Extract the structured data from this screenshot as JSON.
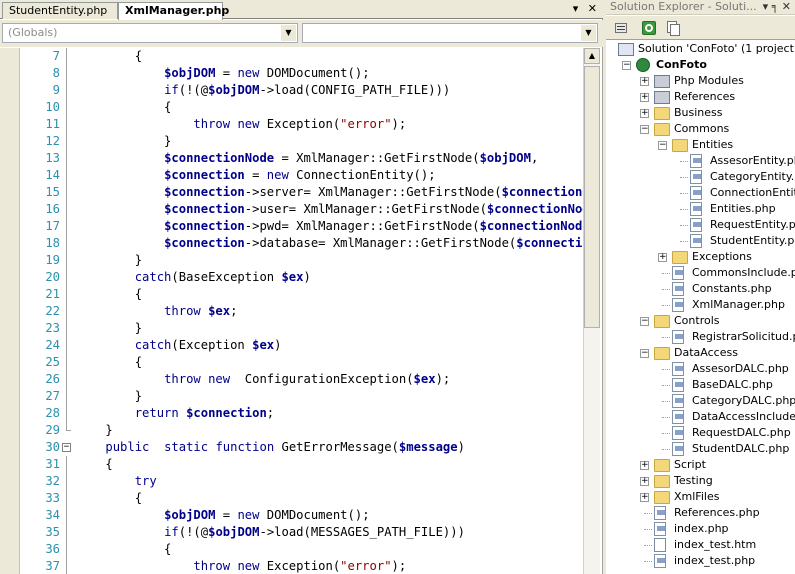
{
  "editor": {
    "tabs": [
      {
        "label": "StudentEntity.php",
        "active": false
      },
      {
        "label": "XmlManager.php",
        "active": true
      }
    ],
    "tab_controls": [
      "▾",
      "✕"
    ],
    "scope_dropdown": "(Globals)",
    "member_dropdown": "",
    "lines": [
      {
        "n": "7",
        "segs": [
          [
            "p",
            "        {"
          ]
        ]
      },
      {
        "n": "8",
        "segs": [
          [
            "p",
            "            "
          ],
          [
            "v",
            "$objDOM"
          ],
          [
            "p",
            " = "
          ],
          [
            "k",
            "new"
          ],
          [
            "p",
            " DOMDocument();"
          ]
        ]
      },
      {
        "n": "9",
        "segs": [
          [
            "p",
            "            "
          ],
          [
            "k",
            "if"
          ],
          [
            "p",
            "(!(@"
          ],
          [
            "v",
            "$objDOM"
          ],
          [
            "p",
            "->load(CONFIG_PATH_FILE)))"
          ]
        ]
      },
      {
        "n": "10",
        "segs": [
          [
            "p",
            "            {"
          ]
        ]
      },
      {
        "n": "11",
        "segs": [
          [
            "p",
            "                "
          ],
          [
            "k",
            "throw"
          ],
          [
            "p",
            " "
          ],
          [
            "k",
            "new"
          ],
          [
            "p",
            " Exception("
          ],
          [
            "s",
            "\"error\""
          ],
          [
            "p",
            ");"
          ]
        ]
      },
      {
        "n": "12",
        "segs": [
          [
            "p",
            "            }"
          ]
        ]
      },
      {
        "n": "13",
        "segs": [
          [
            "p",
            "            "
          ],
          [
            "v",
            "$connectionNode"
          ],
          [
            "p",
            " = XmlManager::GetFirstNode("
          ],
          [
            "v",
            "$objDOM"
          ],
          [
            "p",
            ","
          ]
        ]
      },
      {
        "n": "14",
        "segs": [
          [
            "p",
            "            "
          ],
          [
            "v",
            "$connection"
          ],
          [
            "p",
            " = "
          ],
          [
            "k",
            "new"
          ],
          [
            "p",
            " ConnectionEntity();"
          ]
        ]
      },
      {
        "n": "15",
        "segs": [
          [
            "p",
            "            "
          ],
          [
            "v",
            "$connection"
          ],
          [
            "p",
            "->server= XmlManager::GetFirstNode("
          ],
          [
            "v",
            "$connectionNode"
          ]
        ]
      },
      {
        "n": "16",
        "segs": [
          [
            "p",
            "            "
          ],
          [
            "v",
            "$connection"
          ],
          [
            "p",
            "->user= XmlManager::GetFirstNode("
          ],
          [
            "v",
            "$connectionNode"
          ]
        ]
      },
      {
        "n": "17",
        "segs": [
          [
            "p",
            "            "
          ],
          [
            "v",
            "$connection"
          ],
          [
            "p",
            "->pwd= XmlManager::GetFirstNode("
          ],
          [
            "v",
            "$connectionNode"
          ]
        ]
      },
      {
        "n": "18",
        "segs": [
          [
            "p",
            "            "
          ],
          [
            "v",
            "$connection"
          ],
          [
            "p",
            "->database= XmlManager::GetFirstNode("
          ],
          [
            "v",
            "$connectionNode"
          ]
        ]
      },
      {
        "n": "19",
        "segs": [
          [
            "p",
            "        }"
          ]
        ]
      },
      {
        "n": "20",
        "segs": [
          [
            "p",
            "        "
          ],
          [
            "k",
            "catch"
          ],
          [
            "p",
            "(BaseException "
          ],
          [
            "v",
            "$ex"
          ],
          [
            "p",
            ")"
          ]
        ]
      },
      {
        "n": "21",
        "segs": [
          [
            "p",
            "        {"
          ]
        ]
      },
      {
        "n": "22",
        "segs": [
          [
            "p",
            "            "
          ],
          [
            "k",
            "throw"
          ],
          [
            "p",
            " "
          ],
          [
            "v",
            "$ex"
          ],
          [
            "p",
            ";"
          ]
        ]
      },
      {
        "n": "23",
        "segs": [
          [
            "p",
            "        }"
          ]
        ]
      },
      {
        "n": "24",
        "segs": [
          [
            "p",
            "        "
          ],
          [
            "k",
            "catch"
          ],
          [
            "p",
            "(Exception "
          ],
          [
            "v",
            "$ex"
          ],
          [
            "p",
            ")"
          ]
        ]
      },
      {
        "n": "25",
        "segs": [
          [
            "p",
            "        {"
          ]
        ]
      },
      {
        "n": "26",
        "segs": [
          [
            "p",
            "            "
          ],
          [
            "k",
            "throw"
          ],
          [
            "p",
            " "
          ],
          [
            "k",
            "new"
          ],
          [
            "p",
            "  ConfigurationException("
          ],
          [
            "v",
            "$ex"
          ],
          [
            "p",
            ");"
          ]
        ]
      },
      {
        "n": "27",
        "segs": [
          [
            "p",
            "        }"
          ]
        ]
      },
      {
        "n": "28",
        "segs": [
          [
            "p",
            "        "
          ],
          [
            "k",
            "return"
          ],
          [
            "p",
            " "
          ],
          [
            "v",
            "$connection"
          ],
          [
            "p",
            ";"
          ]
        ]
      },
      {
        "n": "29",
        "segs": [
          [
            "p",
            "    }"
          ]
        ]
      },
      {
        "n": "30",
        "segs": [
          [
            "p",
            "    "
          ],
          [
            "k",
            "public"
          ],
          [
            "p",
            "  "
          ],
          [
            "k",
            "static"
          ],
          [
            "p",
            " "
          ],
          [
            "k",
            "function"
          ],
          [
            "p",
            " GetErrorMessage("
          ],
          [
            "v",
            "$message"
          ],
          [
            "p",
            ")"
          ]
        ]
      },
      {
        "n": "31",
        "segs": [
          [
            "p",
            "    {"
          ]
        ]
      },
      {
        "n": "32",
        "segs": [
          [
            "p",
            "        "
          ],
          [
            "k",
            "try"
          ]
        ]
      },
      {
        "n": "33",
        "segs": [
          [
            "p",
            "        {"
          ]
        ]
      },
      {
        "n": "34",
        "segs": [
          [
            "p",
            "            "
          ],
          [
            "v",
            "$objDOM"
          ],
          [
            "p",
            " = "
          ],
          [
            "k",
            "new"
          ],
          [
            "p",
            " DOMDocument();"
          ]
        ]
      },
      {
        "n": "35",
        "segs": [
          [
            "p",
            "            "
          ],
          [
            "k",
            "if"
          ],
          [
            "p",
            "(!(@"
          ],
          [
            "v",
            "$objDOM"
          ],
          [
            "p",
            "->load(MESSAGES_PATH_FILE)))"
          ]
        ]
      },
      {
        "n": "36",
        "segs": [
          [
            "p",
            "            {"
          ]
        ]
      },
      {
        "n": "37",
        "segs": [
          [
            "p",
            "                "
          ],
          [
            "k",
            "throw"
          ],
          [
            "p",
            " "
          ],
          [
            "k",
            "new"
          ],
          [
            "p",
            " Exception("
          ],
          [
            "s",
            "\"error\""
          ],
          [
            "p",
            ");"
          ]
        ]
      }
    ]
  },
  "solution_explorer": {
    "title": "Solution Explorer - Soluti...",
    "title_controls": "▾ ╕ ✕",
    "items": [
      {
        "label": "Solution 'ConFoto' (1 project)",
        "icon": "solution-icon",
        "level": 0,
        "exp": ""
      },
      {
        "label": "ConFoto",
        "icon": "project-icon",
        "level": 0,
        "exp": "-",
        "bold": true
      },
      {
        "label": "Php Modules",
        "icon": "modules-icon",
        "level": 1,
        "exp": "+"
      },
      {
        "label": "References",
        "icon": "references-icon",
        "level": 1,
        "exp": "+"
      },
      {
        "label": "Business",
        "icon": "folder-icon",
        "level": 1,
        "exp": "+"
      },
      {
        "label": "Commons",
        "icon": "folder-open-icon",
        "level": 1,
        "exp": "-"
      },
      {
        "label": "Entities",
        "icon": "folder-open-icon",
        "level": 2,
        "exp": "-"
      },
      {
        "label": "AssesorEntity.php",
        "icon": "php-file-icon",
        "level": 3,
        "exp": ""
      },
      {
        "label": "CategoryEntity.php",
        "icon": "php-file-icon",
        "level": 3,
        "exp": ""
      },
      {
        "label": "ConnectionEntity.php",
        "icon": "php-file-icon",
        "level": 3,
        "exp": ""
      },
      {
        "label": "Entities.php",
        "icon": "php-file-icon",
        "level": 3,
        "exp": ""
      },
      {
        "label": "RequestEntity.php",
        "icon": "php-file-icon",
        "level": 3,
        "exp": ""
      },
      {
        "label": "StudentEntity.php",
        "icon": "php-file-icon",
        "level": 3,
        "exp": ""
      },
      {
        "label": "Exceptions",
        "icon": "folder-icon",
        "level": 2,
        "exp": "+"
      },
      {
        "label": "CommonsInclude.php",
        "icon": "php-file-icon",
        "level": 2,
        "exp": ""
      },
      {
        "label": "Constants.php",
        "icon": "php-file-icon",
        "level": 2,
        "exp": ""
      },
      {
        "label": "XmlManager.php",
        "icon": "php-file-icon",
        "level": 2,
        "exp": ""
      },
      {
        "label": "Controls",
        "icon": "folder-open-icon",
        "level": 1,
        "exp": "-"
      },
      {
        "label": "RegistrarSolicitud.php",
        "icon": "php-file-icon",
        "level": 2,
        "exp": ""
      },
      {
        "label": "DataAccess",
        "icon": "folder-open-icon",
        "level": 1,
        "exp": "-"
      },
      {
        "label": "AssesorDALC.php",
        "icon": "php-file-icon",
        "level": 2,
        "exp": ""
      },
      {
        "label": "BaseDALC.php",
        "icon": "php-file-icon",
        "level": 2,
        "exp": ""
      },
      {
        "label": "CategoryDALC.php",
        "icon": "php-file-icon",
        "level": 2,
        "exp": ""
      },
      {
        "label": "DataAccessInclude.php",
        "icon": "php-file-icon",
        "level": 2,
        "exp": ""
      },
      {
        "label": "RequestDALC.php",
        "icon": "php-file-icon",
        "level": 2,
        "exp": ""
      },
      {
        "label": "StudentDALC.php",
        "icon": "php-file-icon",
        "level": 2,
        "exp": ""
      },
      {
        "label": "Script",
        "icon": "folder-icon",
        "level": 1,
        "exp": "+"
      },
      {
        "label": "Testing",
        "icon": "folder-icon",
        "level": 1,
        "exp": "+"
      },
      {
        "label": "XmlFiles",
        "icon": "folder-icon",
        "level": 1,
        "exp": "+"
      },
      {
        "label": "References.php",
        "icon": "php-file-icon",
        "level": 1,
        "exp": ""
      },
      {
        "label": "index.php",
        "icon": "php-file-icon",
        "level": 1,
        "exp": ""
      },
      {
        "label": "index_test.htm",
        "icon": "html-file-icon",
        "level": 1,
        "exp": ""
      },
      {
        "label": "index_test.php",
        "icon": "php-file-icon",
        "level": 1,
        "exp": ""
      }
    ]
  }
}
